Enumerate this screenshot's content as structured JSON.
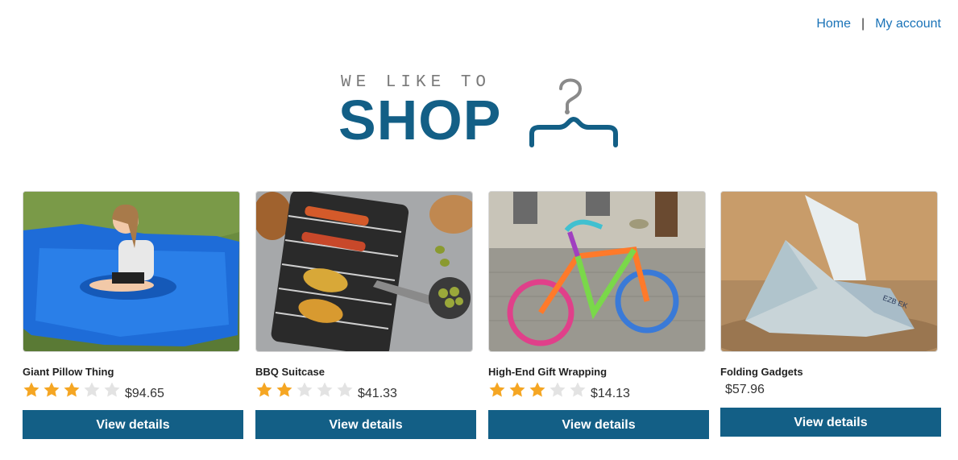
{
  "nav": {
    "home": "Home",
    "separator": "|",
    "account": "My account"
  },
  "logo": {
    "tagline": "WE LIKE TO",
    "brand": "SHOP",
    "icon": "hanger-icon"
  },
  "colors": {
    "brand": "#135f86",
    "link": "#1a73b8",
    "star_filled": "#f5a623",
    "star_empty": "#e3e3e3"
  },
  "products": [
    {
      "name": "Giant Pillow Thing",
      "rating": 3,
      "price": "$94.65",
      "button": "View details"
    },
    {
      "name": "BBQ Suitcase",
      "rating": 2,
      "price": "$41.33",
      "button": "View details"
    },
    {
      "name": "High-End Gift Wrapping",
      "rating": 3,
      "price": "$14.13",
      "button": "View details"
    },
    {
      "name": "Folding Gadgets",
      "rating": null,
      "price": "$57.96",
      "button": "View details"
    }
  ]
}
